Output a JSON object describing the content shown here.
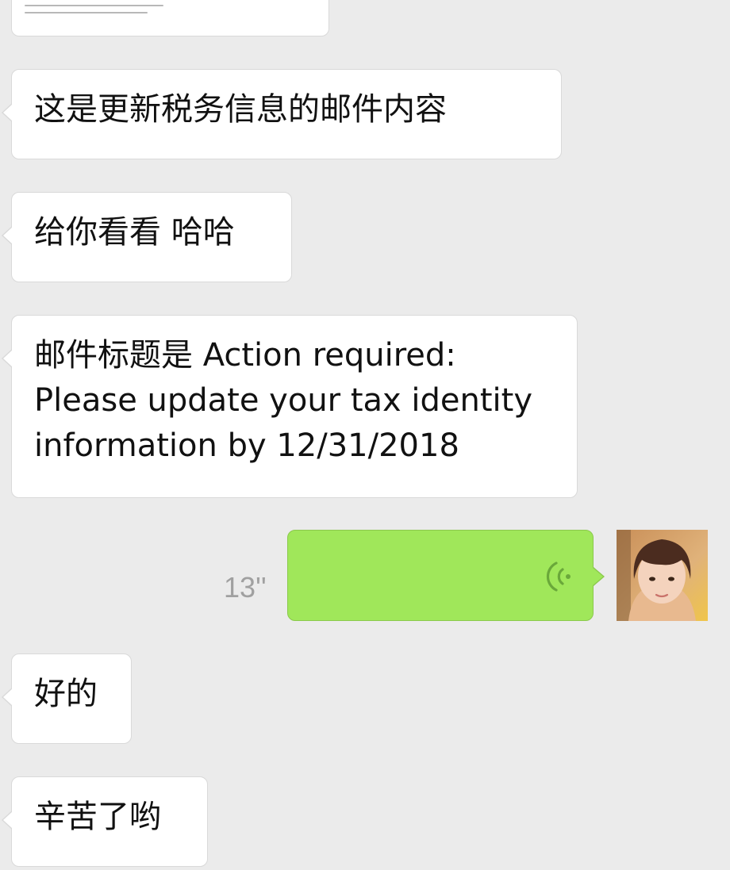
{
  "messages": [
    {
      "text": "这是更新税务信息的邮件内容"
    },
    {
      "text": "给你看看 哈哈"
    },
    {
      "lines": [
        "邮件标题是 Action required:",
        "Please update your tax identity",
        "information by 12/31/2018"
      ]
    },
    {
      "text": "好的"
    },
    {
      "text": "辛苦了哟"
    }
  ],
  "voice_message": {
    "duration": "13''",
    "icon": "voice-wave-icon",
    "bubble_color": "#a0e75a"
  },
  "user_avatar": {
    "icon": "avatar"
  },
  "theme": {
    "background": "#ebebeb",
    "incoming_bubble": "#ffffff"
  }
}
